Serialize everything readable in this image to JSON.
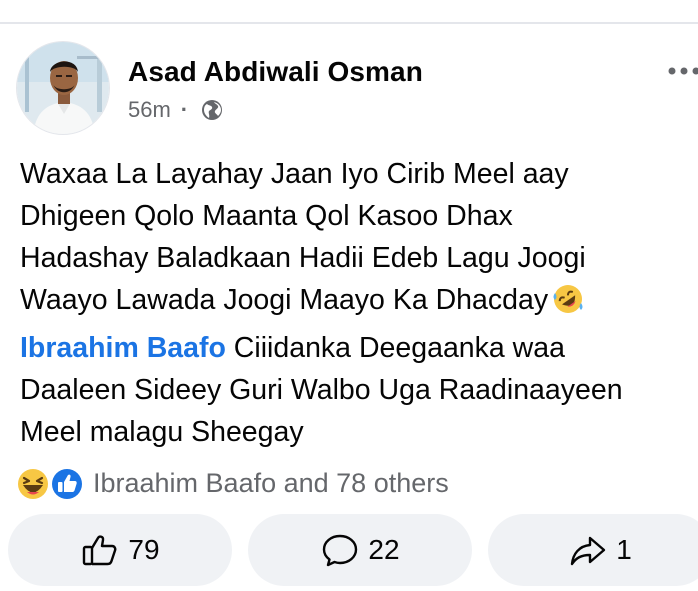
{
  "post": {
    "author": "Asad Abdiwali Osman",
    "time": "56m",
    "separator": "·",
    "privacy_icon": "globe-icon",
    "more_icon": "more-horizontal-icon",
    "text_lines": [
      "Waxaa La Layahay Jaan Iyo Cirib Meel aay",
      "Dhigeen Qolo Maanta Qol Kasoo Dhax",
      "Hadashay Baladkaan Hadii Edeb Lagu Joogi",
      "Waayo Lawada Joogi Maayo Ka Dhacday"
    ],
    "line4_emoji": "rolling-on-floor-laughing-emoji",
    "mention": "Ibraahim Baafo",
    "line5_rest": " Ciiidanka Deegaanka waa",
    "text_lines_after": [
      "Daaleen Sideey Guri Walbo Uga Raadinaayeen",
      "Meel malagu Sheegay"
    ],
    "colors": {
      "mention": "#1b74e4",
      "secondary_text": "#65676b",
      "button_bg": "#f0f2f5"
    }
  },
  "reactions": {
    "icons": [
      "haha-reaction-icon",
      "like-reaction-icon"
    ],
    "summary": "Ibraahim Baafo and 78 others"
  },
  "actions": {
    "like": {
      "icon": "thumbs-up-icon",
      "count": "79"
    },
    "comment": {
      "icon": "comment-bubble-icon",
      "count": "22"
    },
    "share": {
      "icon": "share-arrow-icon",
      "count": "1"
    }
  }
}
